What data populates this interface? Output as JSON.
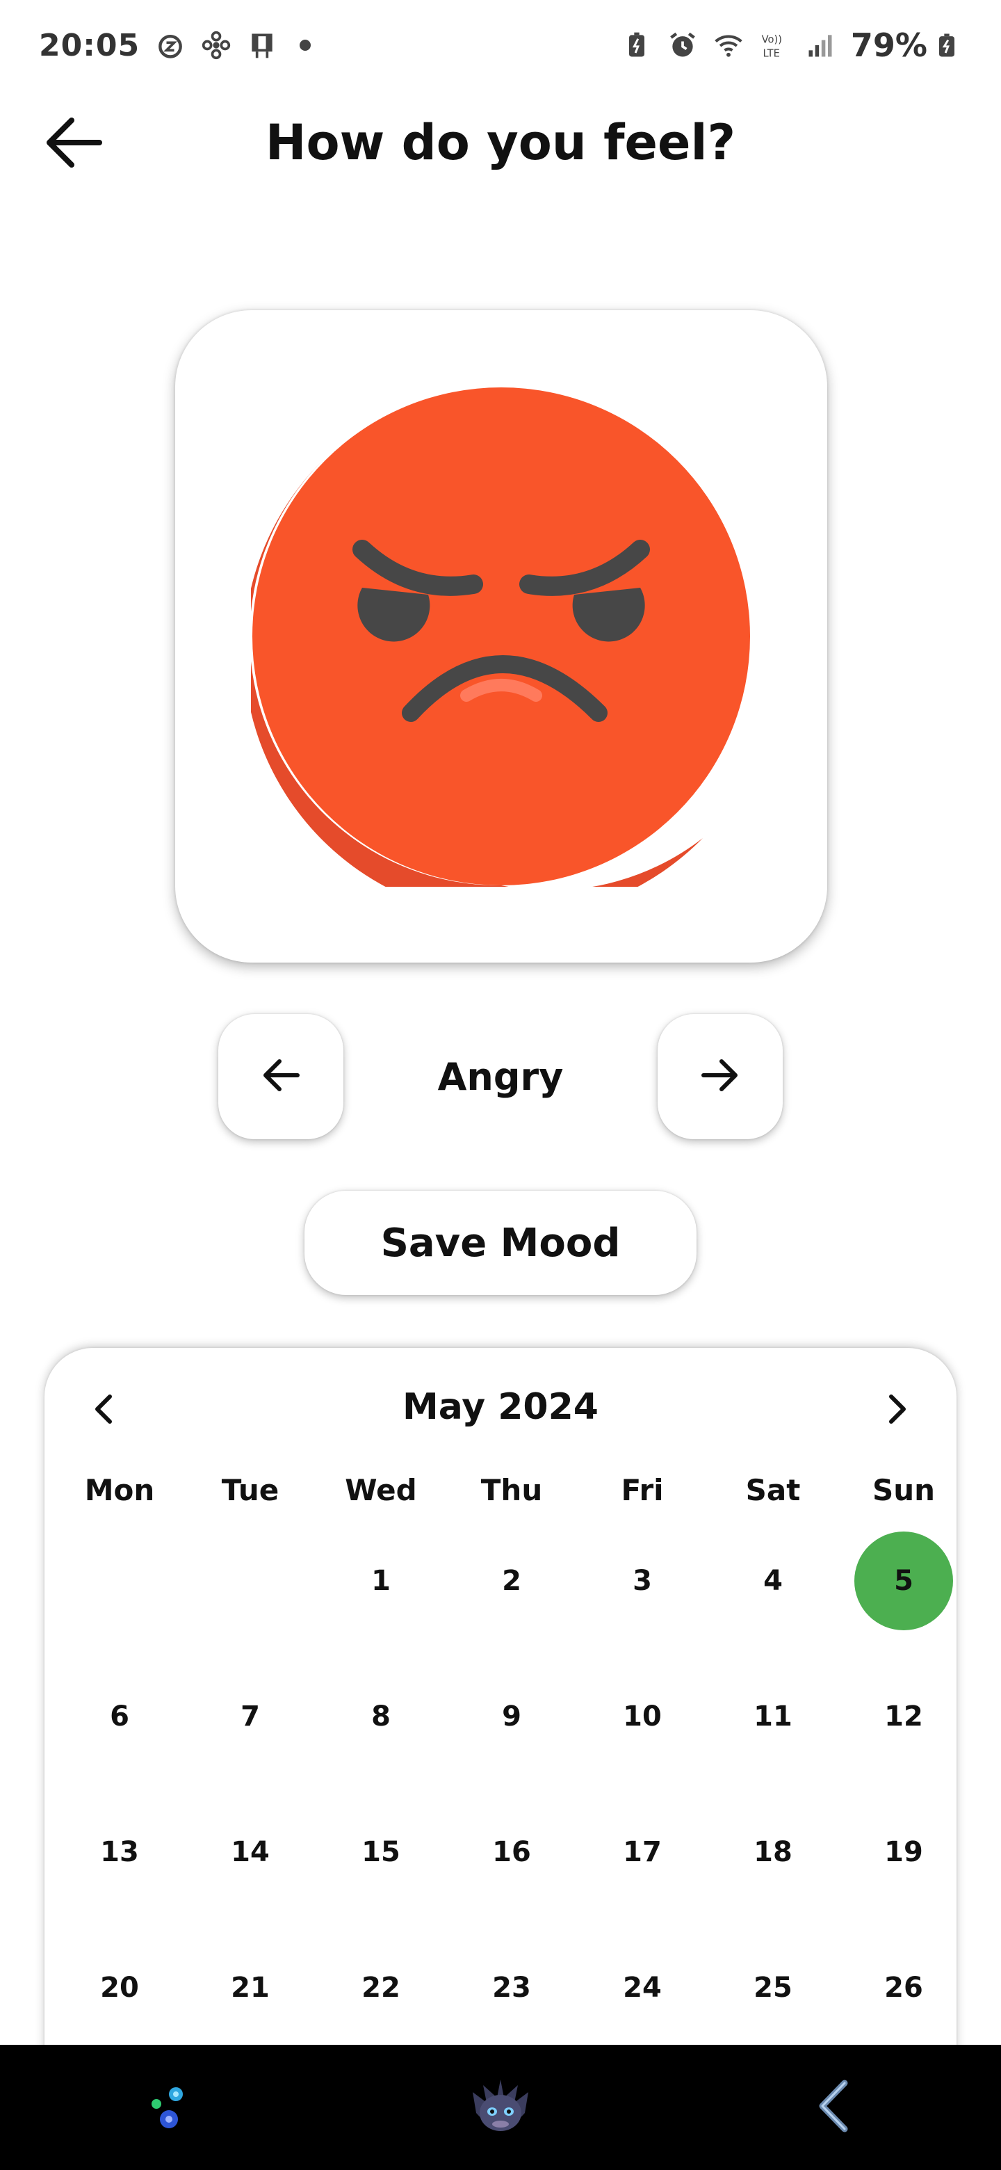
{
  "status_bar": {
    "time": "20:05",
    "battery": "79%",
    "icons": [
      "alarm-snooze-icon",
      "fan-icon",
      "screen-icon",
      "battery-saver-icon",
      "alarm-icon",
      "wifi-icon",
      "volte-icon",
      "signal-icon",
      "battery-icon"
    ]
  },
  "header": {
    "title": "How do you feel?",
    "back_icon": "arrow-left-icon"
  },
  "mood": {
    "current": "Angry",
    "emoji": "angry-face",
    "prev_icon": "arrow-left-icon",
    "next_icon": "arrow-right-icon",
    "colors": {
      "face": "#F9552A",
      "face_shadow": "#E54B2B",
      "features": "#474747",
      "mouth_highlight": "#FF7A5C"
    }
  },
  "actions": {
    "save_label": "Save Mood"
  },
  "calendar": {
    "title": "May 2024",
    "weekdays": [
      "Mon",
      "Tue",
      "Wed",
      "Thu",
      "Fri",
      "Sat",
      "Sun"
    ],
    "days": [
      "",
      "",
      "1",
      "2",
      "3",
      "4",
      "5",
      "6",
      "7",
      "8",
      "9",
      "10",
      "11",
      "12",
      "13",
      "14",
      "15",
      "16",
      "17",
      "18",
      "19",
      "20",
      "21",
      "22",
      "23",
      "24",
      "25",
      "26"
    ],
    "selected_day": "5",
    "selected_color": "#4CAF50"
  },
  "bottom_nav": {
    "items": [
      "assistant-orbs-icon",
      "dragon-avatar-icon",
      "back-gesture-icon"
    ]
  }
}
